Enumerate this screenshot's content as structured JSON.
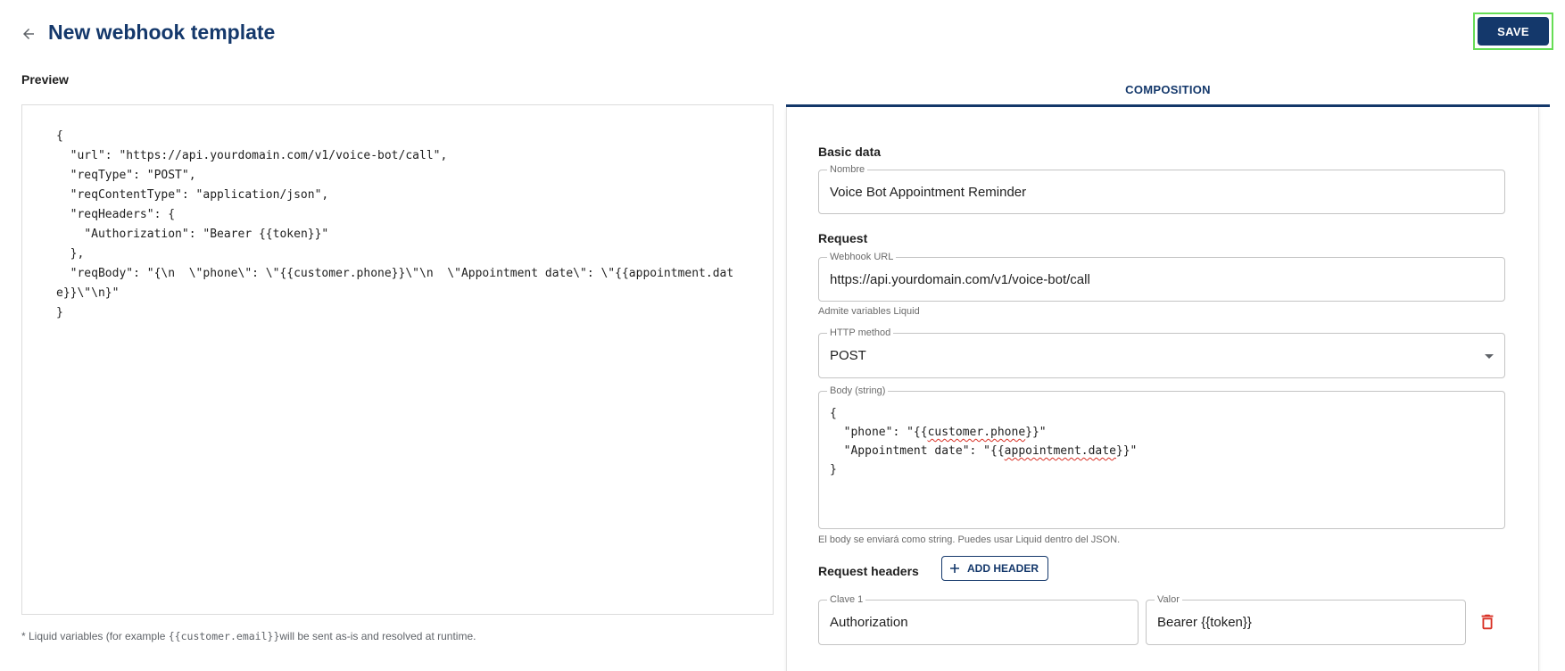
{
  "header": {
    "title": "New webhook template",
    "save_label": "SAVE"
  },
  "preview": {
    "label": "Preview",
    "code": "{\n  \"url\": \"https://api.yourdomain.com/v1/voice-bot/call\",\n  \"reqType\": \"POST\",\n  \"reqContentType\": \"application/json\",\n  \"reqHeaders\": {\n    \"Authorization\": \"Bearer {{token}}\"\n  },\n  \"reqBody\": \"{\\n  \\\"phone\\\": \\\"{{customer.phone}}\\\"\\n  \\\"Appointment date\\\": \\\"{{appointment.date}}\\\"\\n}\"\n}",
    "footnote_prefix": "* Liquid variables (for example ",
    "footnote_code": "{{customer.email}}",
    "footnote_suffix": "will be sent as-is and resolved at runtime."
  },
  "tabs": [
    {
      "label": "COMPOSITION",
      "active": true
    }
  ],
  "composition": {
    "basic_data_title": "Basic data",
    "name_label": "Nombre",
    "name_value": "Voice Bot Appointment Reminder",
    "request_title": "Request",
    "url_label": "Webhook URL",
    "url_value": "https://api.yourdomain.com/v1/voice-bot/call",
    "url_helper": "Admite variables Liquid",
    "method_label": "HTTP method",
    "method_value": "POST",
    "body_label": "Body (string)",
    "body": {
      "open": "{",
      "l1_a": "  \"phone\": \"{{",
      "l1_var": "customer.phone",
      "l1_b": "}}\"",
      "l2_a": "  \"Appointment date\": \"{{",
      "l2_var": "appointment.date",
      "l2_b": "}}\"",
      "close": "}"
    },
    "body_helper": "El body se enviará como string. Puedes usar Liquid dentro del JSON.",
    "headers_title": "Request headers",
    "add_header_label": "ADD HEADER",
    "header_rows": [
      {
        "key_label": "Clave 1",
        "key_value": "Authorization",
        "value_label": "Valor",
        "value_value": "Bearer {{token}}"
      }
    ]
  },
  "colors": {
    "primary": "#14386b",
    "danger": "#d93025",
    "save_focus_ring": "#66dd55"
  },
  "icons": [
    "arrow-left-icon",
    "plus-icon",
    "trash-icon",
    "chevron-down-icon"
  ]
}
